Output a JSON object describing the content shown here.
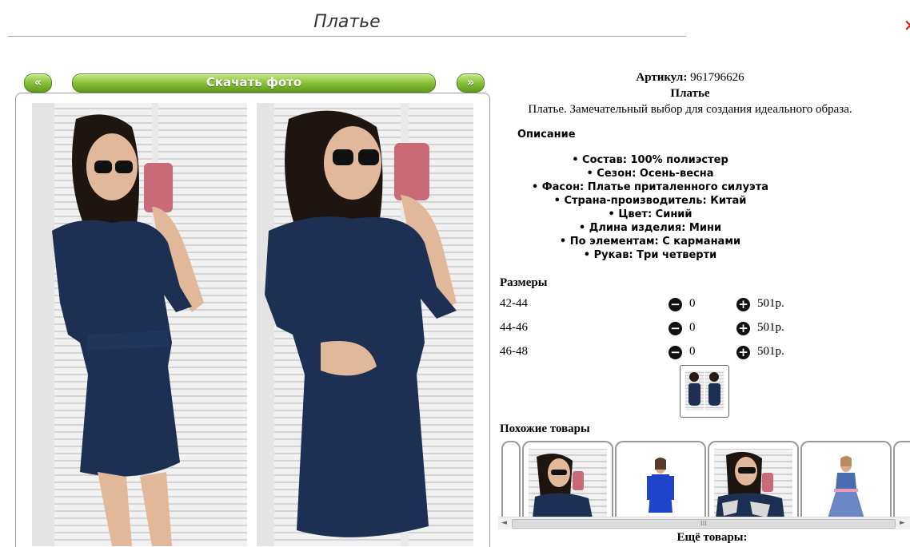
{
  "page": {
    "title": "Платье",
    "close_glyph": "✕"
  },
  "gallery": {
    "prev_label": "«",
    "download_label": "Скачать фото",
    "next_label": "»"
  },
  "product": {
    "article_label": "Артикул:",
    "article_value": "961796626",
    "name": "Платье",
    "short_description": "Платье. Замечательный выбор для создания идеального образа.",
    "description_heading": "Описание",
    "specs": [
      "Состав: 100% полиэстер",
      "Сезон: Осень-весна",
      "Фасон: Платье приталенного силуэта",
      "Страна-производитель: Китай",
      "Цвет: Синий",
      "Длина изделия: Мини",
      "По элементам: С карманами",
      "Рукав: Три четверти"
    ]
  },
  "sizes": {
    "heading": "Размеры",
    "minus_icon": "minus-circle-icon",
    "plus_icon": "plus-circle-icon",
    "rows": [
      {
        "label": "42-44",
        "qty": "0",
        "price": "501р."
      },
      {
        "label": "44-46",
        "qty": "0",
        "price": "501р."
      },
      {
        "label": "46-48",
        "qty": "0",
        "price": "501р."
      }
    ]
  },
  "similar": {
    "heading": "Похожие товары"
  },
  "more": {
    "heading": "Ещё товары:"
  },
  "scrollbar": {
    "left_arrow": "◄",
    "right_arrow": "►",
    "grip": "III"
  },
  "colors": {
    "button_green": "#8cc63e",
    "dress_navy": "#1d2f52"
  }
}
